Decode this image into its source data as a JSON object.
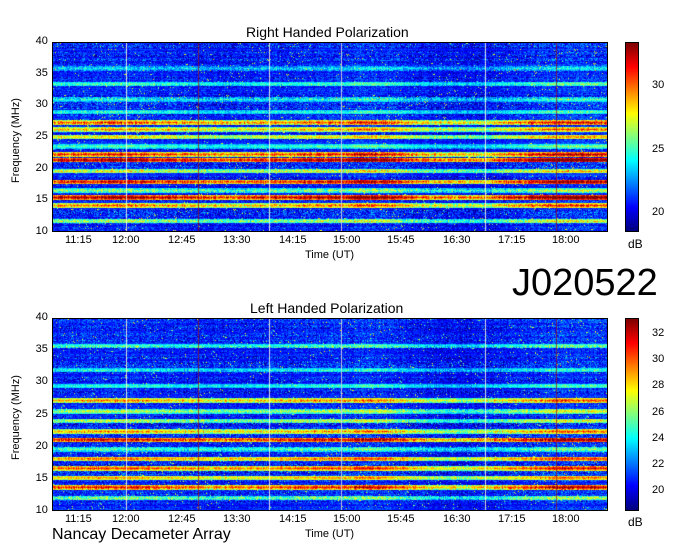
{
  "chart_data": [
    {
      "type": "heatmap",
      "title": "Right Handed Polarization",
      "xlabel": "Time (UT)",
      "ylabel": "Frequency (MHz)",
      "x_ticks": [
        "11:15",
        "12:00",
        "12:45",
        "13:30",
        "14:15",
        "15:00",
        "15:45",
        "16:30",
        "17:15",
        "18:00"
      ],
      "y_ticks": [
        "10",
        "15",
        "20",
        "25",
        "30",
        "35",
        "40"
      ],
      "ylim": [
        10,
        40
      ],
      "colorbar_ticks": [
        "20",
        "25",
        "30"
      ],
      "colorbar_range": [
        18.5,
        33.5
      ],
      "colorbar_unit": "dB",
      "colormap": "jet",
      "bands": [
        {
          "freq": 11.5,
          "level": 0.55
        },
        {
          "freq": 13.0,
          "level": 0.15
        },
        {
          "freq": 14.0,
          "level": 0.75
        },
        {
          "freq": 15.3,
          "level": 0.98
        },
        {
          "freq": 16.4,
          "level": 0.5
        },
        {
          "freq": 17.8,
          "level": 0.9
        },
        {
          "freq": 19.5,
          "level": 0.6
        },
        {
          "freq": 21.3,
          "level": 0.97
        },
        {
          "freq": 22.2,
          "level": 0.85
        },
        {
          "freq": 23.5,
          "level": 0.45
        },
        {
          "freq": 25.0,
          "level": 0.65
        },
        {
          "freq": 26.2,
          "level": 0.7
        },
        {
          "freq": 27.3,
          "level": 0.8
        },
        {
          "freq": 29.0,
          "level": 0.42
        },
        {
          "freq": 31.0,
          "level": 0.4
        },
        {
          "freq": 33.5,
          "level": 0.45
        },
        {
          "freq": 36.0,
          "level": 0.35
        }
      ]
    },
    {
      "type": "heatmap",
      "title": "Left Handed Polarization",
      "xlabel": "Time (UT)",
      "ylabel": "Frequency (MHz)",
      "x_ticks": [
        "11:15",
        "12:00",
        "12:45",
        "13:30",
        "14:15",
        "15:00",
        "15:45",
        "16:30",
        "17:15",
        "18:00"
      ],
      "y_ticks": [
        "10",
        "15",
        "20",
        "25",
        "30",
        "35",
        "40"
      ],
      "ylim": [
        10,
        40
      ],
      "colorbar_ticks": [
        "20",
        "22",
        "24",
        "26",
        "28",
        "30",
        "32"
      ],
      "colorbar_range": [
        18.5,
        33.2
      ],
      "colorbar_unit": "dB",
      "colormap": "jet",
      "bands": [
        {
          "freq": 11.8,
          "level": 0.5
        },
        {
          "freq": 13.5,
          "level": 0.85
        },
        {
          "freq": 15.0,
          "level": 0.7
        },
        {
          "freq": 16.5,
          "level": 0.8
        },
        {
          "freq": 18.0,
          "level": 0.75
        },
        {
          "freq": 19.5,
          "level": 0.45
        },
        {
          "freq": 21.0,
          "level": 0.9
        },
        {
          "freq": 22.3,
          "level": 0.7
        },
        {
          "freq": 24.0,
          "level": 0.55
        },
        {
          "freq": 25.5,
          "level": 0.55
        },
        {
          "freq": 27.2,
          "level": 0.72
        },
        {
          "freq": 29.5,
          "level": 0.42
        },
        {
          "freq": 32.0,
          "level": 0.4
        },
        {
          "freq": 35.8,
          "level": 0.45
        }
      ]
    }
  ],
  "observation_id": "J020522",
  "instrument": "Nancay Decameter Array"
}
